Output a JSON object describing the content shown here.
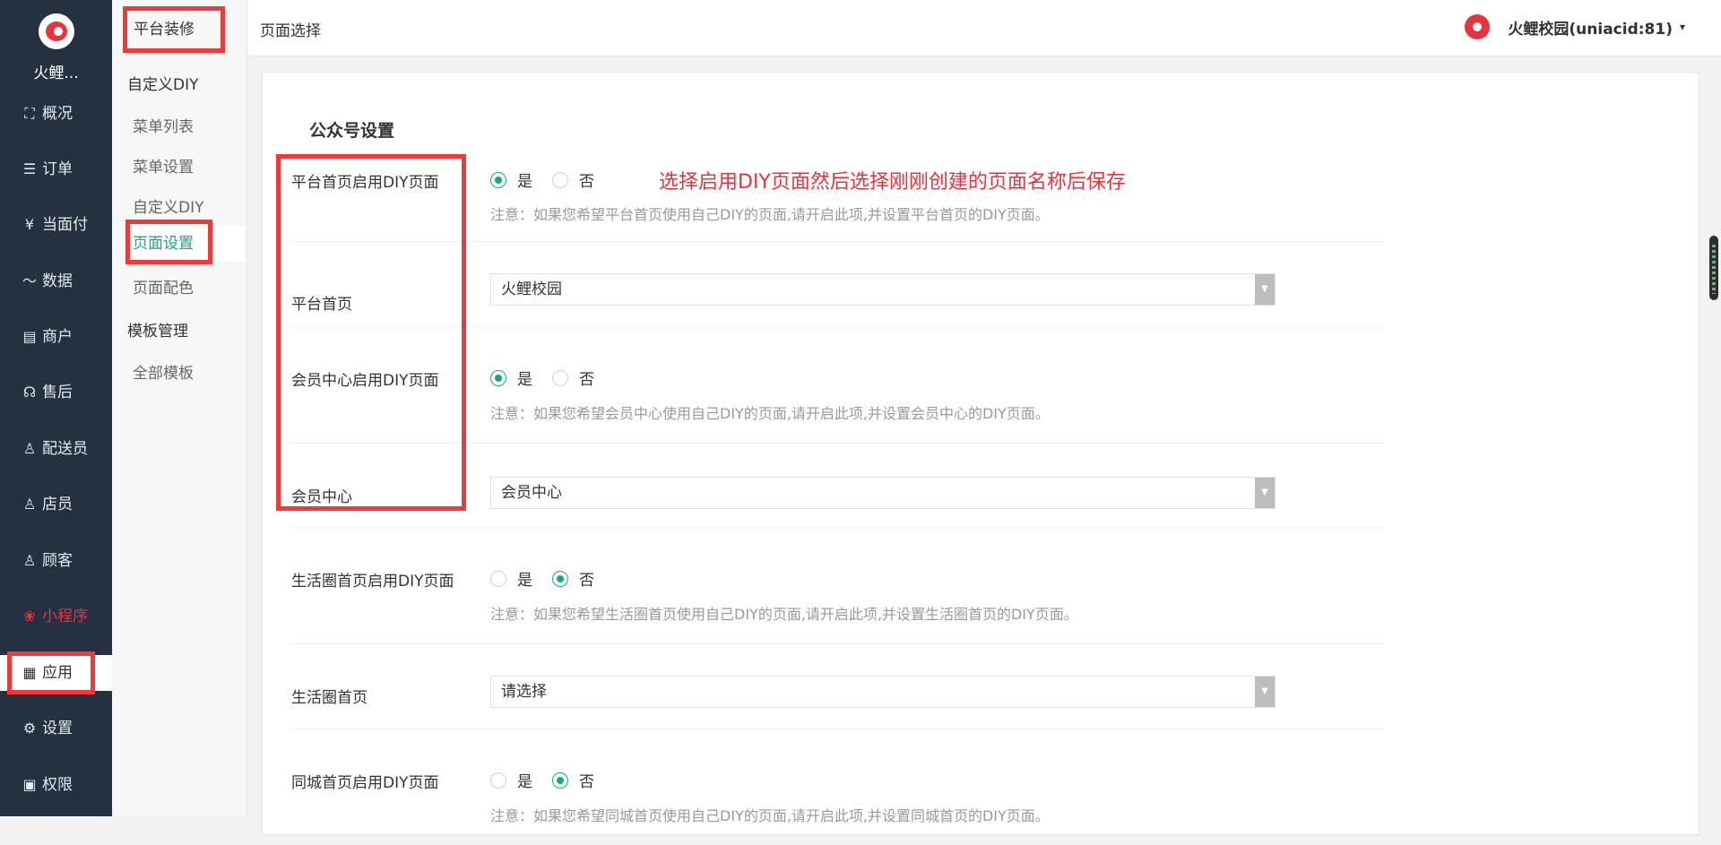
{
  "sidebar": {
    "site_name": "火鲤...",
    "items": [
      {
        "label": "概况",
        "icon": "overview-icon",
        "glyph": "⛶"
      },
      {
        "label": "订单",
        "icon": "order-icon",
        "glyph": "☰"
      },
      {
        "label": "当面付",
        "icon": "yen-icon",
        "glyph": "¥"
      },
      {
        "label": "数据",
        "icon": "chart-icon",
        "glyph": "〜"
      },
      {
        "label": "商户",
        "icon": "store-icon",
        "glyph": "▤"
      },
      {
        "label": "售后",
        "icon": "headset-icon",
        "glyph": "☊"
      },
      {
        "label": "配送员",
        "icon": "courier-icon",
        "glyph": "♙"
      },
      {
        "label": "店员",
        "icon": "clerk-icon",
        "glyph": "♙"
      },
      {
        "label": "顾客",
        "icon": "customer-icon",
        "glyph": "♙"
      },
      {
        "label": "小程序",
        "icon": "miniprogram-icon",
        "glyph": "❀"
      },
      {
        "label": "应用",
        "icon": "apps-icon",
        "glyph": "▦"
      },
      {
        "label": "设置",
        "icon": "gear-icon",
        "glyph": "⚙"
      },
      {
        "label": "权限",
        "icon": "lock-icon",
        "glyph": "🔒"
      }
    ]
  },
  "subnav": {
    "title": "平台装修",
    "groups": [
      {
        "label": "自定义DIY",
        "items": [
          "菜单列表",
          "菜单设置",
          "自定义DIY",
          "页面设置",
          "页面配色"
        ]
      },
      {
        "label": "模板管理",
        "items": [
          "全部模板"
        ]
      }
    ]
  },
  "header": {
    "title": "页面选择",
    "user": "火鲤校园(uniacid:81)",
    "caret": "▾"
  },
  "main": {
    "section_title": "公众号设置",
    "annotation": "选择启用DIY页面然后选择刚刚创建的页面名称后保存",
    "yes": "是",
    "no": "否",
    "rows": {
      "platform_diy": {
        "label": "平台首页启用DIY页面",
        "selected": "是",
        "note": "注意：如果您希望平台首页使用自己DIY的页面,请开启此项,并设置平台首页的DIY页面。"
      },
      "platform_home": {
        "label": "平台首页",
        "value": "火鲤校园"
      },
      "member_diy": {
        "label": "会员中心启用DIY页面",
        "selected": "是",
        "note": "注意：如果您希望会员中心使用自己DIY的页面,请开启此项,并设置会员中心的DIY页面。"
      },
      "member_center": {
        "label": "会员中心",
        "value": "会员中心"
      },
      "life_diy": {
        "label": "生活圈首页启用DIY页面",
        "selected": "否",
        "note": "注意：如果您希望生活圈首页使用自己DIY的页面,请开启此项,并设置生活圈首页的DIY页面。"
      },
      "life_home": {
        "label": "生活圈首页",
        "value": "请选择"
      },
      "city_diy": {
        "label": "同城首页启用DIY页面",
        "selected": "否",
        "note": "注意：如果您希望同城首页使用自己DIY的页面,请开启此项,并设置同城首页的DIY页面。"
      }
    }
  },
  "colors": {
    "accent": "#18a689",
    "brand": "#e8333d",
    "highlight": "#ee3a3a",
    "sidebar": "#233140"
  }
}
